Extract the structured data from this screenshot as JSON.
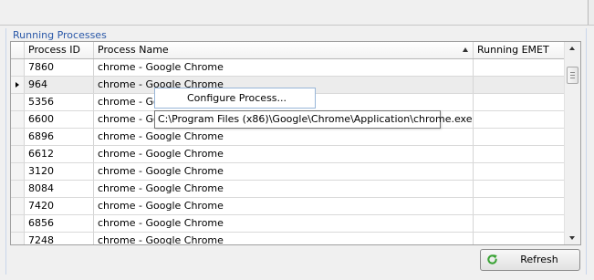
{
  "section": {
    "title": "Running Processes"
  },
  "grid": {
    "columns": [
      "Process ID",
      "Process Name",
      "Running EMET"
    ],
    "sorted_column": "Process Name",
    "sort_direction": "ascending",
    "selected_row_index": 1,
    "rows": [
      {
        "pid": "7860",
        "name": "chrome - Google Chrome",
        "emet": ""
      },
      {
        "pid": "964",
        "name": "chrome - Google Chrome",
        "emet": ""
      },
      {
        "pid": "5356",
        "name": "chrome - Goo",
        "emet": ""
      },
      {
        "pid": "6600",
        "name": "chrome - Goo",
        "emet": ""
      },
      {
        "pid": "6896",
        "name": "chrome - Google Chrome",
        "emet": ""
      },
      {
        "pid": "6612",
        "name": "chrome - Google Chrome",
        "emet": ""
      },
      {
        "pid": "3120",
        "name": "chrome - Google Chrome",
        "emet": ""
      },
      {
        "pid": "8084",
        "name": "chrome - Google Chrome",
        "emet": ""
      },
      {
        "pid": "7420",
        "name": "chrome - Google Chrome",
        "emet": ""
      },
      {
        "pid": "6856",
        "name": "chrome - Google Chrome",
        "emet": ""
      },
      {
        "pid": "7248",
        "name": "chrome - Google Chrome",
        "emet": ""
      }
    ]
  },
  "context_menu": {
    "items": [
      "Configure Process..."
    ]
  },
  "tooltip": {
    "text": "C:\\Program Files (x86)\\Google\\Chrome\\Application\\chrome.exe"
  },
  "refresh_button": {
    "label": "Refresh",
    "icon": "refresh-icon"
  },
  "colors": {
    "group_title": "#2a58a8",
    "refresh_icon": "#3aa335"
  }
}
